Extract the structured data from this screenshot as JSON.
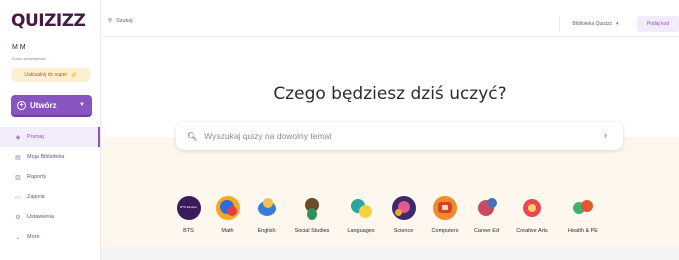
{
  "brand": {
    "logo_text": "QUIZIZZ"
  },
  "sidebar": {
    "user_name": "M M",
    "account_type": "Konto podstawowe",
    "upgrade_label": "Uaktualnij do super",
    "create_label": "Utwórz",
    "items": [
      {
        "label": "Poznaj",
        "icon": "compass-icon",
        "active": true
      },
      {
        "label": "Moja Biblioteka",
        "icon": "library-icon",
        "active": false
      },
      {
        "label": "Raporty",
        "icon": "reports-icon",
        "active": false
      },
      {
        "label": "Zajęcia",
        "icon": "classes-icon",
        "active": false
      },
      {
        "label": "Ustawienia",
        "icon": "settings-icon",
        "active": false
      },
      {
        "label": "More",
        "icon": "chevron-down-icon",
        "active": false
      }
    ]
  },
  "topbar": {
    "search_label": "Szukaj",
    "library_select": "Biblioteka Quizizz",
    "enter_code_label": "Podaj kod"
  },
  "main": {
    "headline": "Czego będziesz dziś uczyć?",
    "search_placeholder": "Wyszukaj quizy na dowolny temat",
    "categories": [
      {
        "label": "BTS",
        "icon_text": "BTS Explore"
      },
      {
        "label": "Math"
      },
      {
        "label": "English"
      },
      {
        "label": "Social Studies"
      },
      {
        "label": "Languages"
      },
      {
        "label": "Science"
      },
      {
        "label": "Computers"
      },
      {
        "label": "Career Ed"
      },
      {
        "label": "Creative Arts"
      },
      {
        "label": "Health & PE"
      }
    ]
  },
  "colors": {
    "brand_purple": "#8854c0",
    "logo_dark": "#461a42",
    "upgrade_bg": "#fdf0d0",
    "lower_bg": "#fdf7ed"
  }
}
